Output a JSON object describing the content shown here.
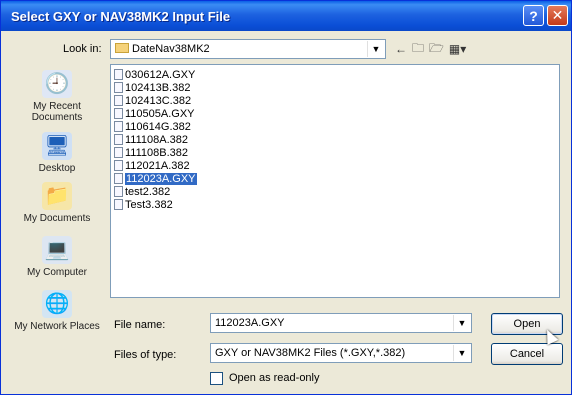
{
  "window": {
    "title": "Select GXY or NAV38MK2 Input File",
    "help_label": "?",
    "close_label": "✕"
  },
  "lookin": {
    "label": "Look in:",
    "value": "DateNav38MK2"
  },
  "places": [
    {
      "label": "My Recent Documents",
      "icon": "recent-documents-icon"
    },
    {
      "label": "Desktop",
      "icon": "desktop-icon"
    },
    {
      "label": "My Documents",
      "icon": "my-documents-icon"
    },
    {
      "label": "My Computer",
      "icon": "my-computer-icon"
    },
    {
      "label": "My Network Places",
      "icon": "network-places-icon"
    }
  ],
  "files": [
    {
      "name": "030612A.GXY"
    },
    {
      "name": "102413B.382"
    },
    {
      "name": "102413C.382"
    },
    {
      "name": "110505A.GXY"
    },
    {
      "name": "110614G.382"
    },
    {
      "name": "111108A.382"
    },
    {
      "name": "111108B.382"
    },
    {
      "name": "112021A.382"
    },
    {
      "name": "112023A.GXY"
    },
    {
      "name": "test2.382"
    },
    {
      "name": "Test3.382"
    }
  ],
  "selected_file": "112023A.GXY",
  "form": {
    "filename_label": "File name:",
    "filename_value": "112023A.GXY",
    "filetype_label": "Files of type:",
    "filetype_value": "GXY or NAV38MK2 Files (*.GXY,*.382)",
    "readonly_label": "Open as read-only",
    "readonly_checked": false
  },
  "buttons": {
    "open": "Open",
    "cancel": "Cancel"
  },
  "colors": {
    "titlebar": "#0A58DC",
    "selection": "#316AC5",
    "dialog_bg": "#ECE9D8"
  }
}
